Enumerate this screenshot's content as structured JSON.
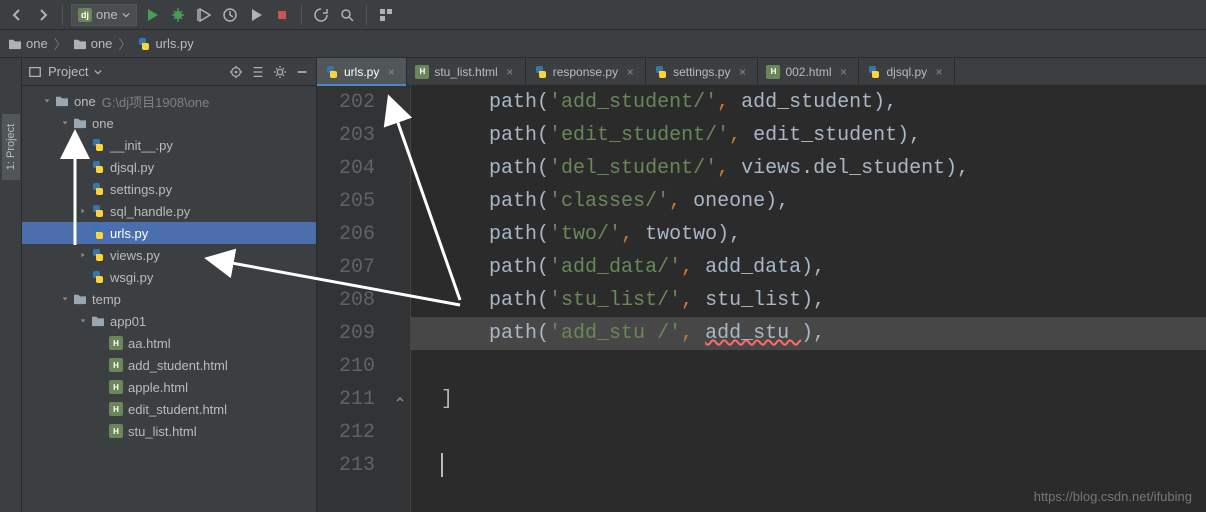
{
  "toolbar": {
    "run_config": "one"
  },
  "breadcrumbs": [
    {
      "name": "one",
      "type": "folder"
    },
    {
      "name": "one",
      "type": "folder"
    },
    {
      "name": "urls.py",
      "type": "py"
    }
  ],
  "side_tool": {
    "label": "1: Project"
  },
  "project": {
    "title": "Project",
    "root": {
      "name": "one",
      "path": "G:\\dj项目1908\\one"
    },
    "tree": [
      {
        "depth": 0,
        "arrow": "down",
        "icon": "folder",
        "label": "one",
        "pathSuffix": "G:\\dj项目1908\\one"
      },
      {
        "depth": 1,
        "arrow": "down",
        "icon": "folder",
        "label": "one"
      },
      {
        "depth": 2,
        "arrow": "",
        "icon": "py",
        "label": "__init__.py"
      },
      {
        "depth": 2,
        "arrow": "",
        "icon": "py",
        "label": "djsql.py"
      },
      {
        "depth": 2,
        "arrow": "",
        "icon": "py",
        "label": "settings.py"
      },
      {
        "depth": 2,
        "arrow": "right",
        "icon": "py",
        "label": "sql_handle.py"
      },
      {
        "depth": 2,
        "arrow": "",
        "icon": "py",
        "label": "urls.py",
        "selected": true
      },
      {
        "depth": 2,
        "arrow": "right",
        "icon": "py",
        "label": "views.py"
      },
      {
        "depth": 2,
        "arrow": "",
        "icon": "py",
        "label": "wsgi.py"
      },
      {
        "depth": 1,
        "arrow": "down",
        "icon": "folder",
        "label": "temp"
      },
      {
        "depth": 2,
        "arrow": "down",
        "icon": "folder",
        "label": "app01"
      },
      {
        "depth": 3,
        "arrow": "",
        "icon": "html",
        "label": "aa.html"
      },
      {
        "depth": 3,
        "arrow": "",
        "icon": "html",
        "label": "add_student.html"
      },
      {
        "depth": 3,
        "arrow": "",
        "icon": "html",
        "label": "apple.html"
      },
      {
        "depth": 3,
        "arrow": "",
        "icon": "html",
        "label": "edit_student.html"
      },
      {
        "depth": 3,
        "arrow": "",
        "icon": "html",
        "label": "stu_list.html"
      }
    ]
  },
  "editor_tabs": [
    {
      "icon": "py",
      "label": "urls.py",
      "active": true
    },
    {
      "icon": "html",
      "label": "stu_list.html",
      "active": false
    },
    {
      "icon": "py",
      "label": "response.py",
      "active": false
    },
    {
      "icon": "py",
      "label": "settings.py",
      "active": false
    },
    {
      "icon": "html",
      "label": "002.html",
      "active": false
    },
    {
      "icon": "py",
      "label": "djsql.py",
      "active": false
    }
  ],
  "code": {
    "first_line_no": 202,
    "lines": [
      {
        "fn": "path",
        "str": "'add_student/'",
        "id": "add_student",
        "end": "),"
      },
      {
        "fn": "path",
        "str": "'edit_student/'",
        "id": "edit_student",
        "end": "),"
      },
      {
        "fn": "path",
        "str": "'del_student/'",
        "id": "views.del_student",
        "end": "),"
      },
      {
        "fn": "path",
        "str": "'classes/'",
        "id": "oneone",
        "end": "),"
      },
      {
        "fn": "path",
        "str": "'two/'",
        "id": "twotwo",
        "end": "),"
      },
      {
        "fn": "path",
        "str": "'add_data/'",
        "id": "add_data",
        "end": "),"
      },
      {
        "fn": "path",
        "str": "'stu_list/'",
        "id": "stu_list",
        "end": "),"
      },
      {
        "fn": "path",
        "str": "'add_stu /'",
        "id": "add_stu ",
        "end": "),",
        "err": true,
        "highlight": true
      },
      {
        "raw": ""
      },
      {
        "raw": "]",
        "fold": true
      },
      {
        "raw": ""
      },
      {
        "raw": "",
        "caret": true
      }
    ]
  },
  "watermark": "https://blog.csdn.net/ifubing"
}
